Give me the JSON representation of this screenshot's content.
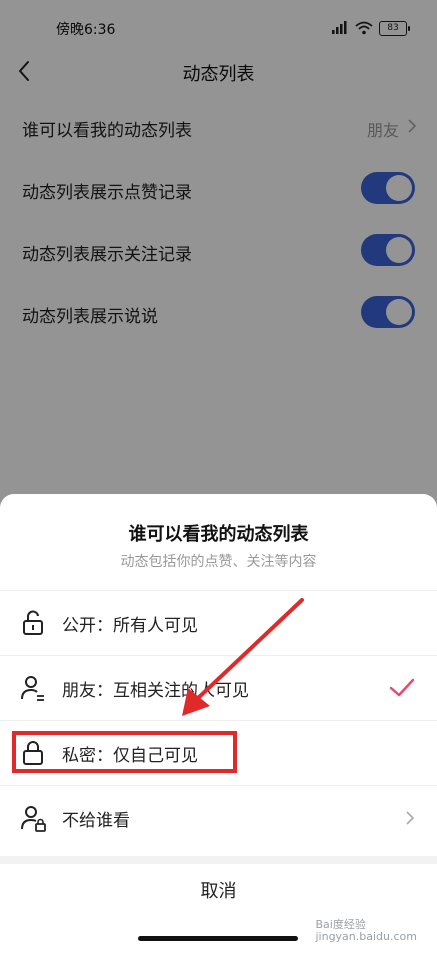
{
  "status_bar": {
    "time": "傍晚6:36",
    "battery": "83"
  },
  "header": {
    "title": "动态列表"
  },
  "settings": {
    "visibility_label": "谁可以看我的动态列表",
    "visibility_value": "朋友",
    "toggles": [
      {
        "label": "动态列表展示点赞记录",
        "on": true
      },
      {
        "label": "动态列表展示关注记录",
        "on": true
      },
      {
        "label": "动态列表展示说说",
        "on": true
      }
    ]
  },
  "sheet": {
    "title": "谁可以看我的动态列表",
    "subtitle": "动态包括你的点赞、关注等内容",
    "options": [
      {
        "label": "公开：所有人可见",
        "icon": "unlock-icon",
        "selected": false
      },
      {
        "label": "朋友：互相关注的人可见",
        "icon": "friends-icon",
        "selected": true
      },
      {
        "label": "私密：仅自己可见",
        "icon": "lock-icon",
        "selected": false
      },
      {
        "label": "不给谁看",
        "icon": "user-block-icon",
        "selected": false
      }
    ],
    "cancel": "取消"
  },
  "colors": {
    "toggle_on": "#3d63d8",
    "check": "#e8466a",
    "annotation": "#e02a2a"
  },
  "watermark": {
    "line1": "Bai度经验",
    "line2": "jingyan.baidu.com"
  }
}
